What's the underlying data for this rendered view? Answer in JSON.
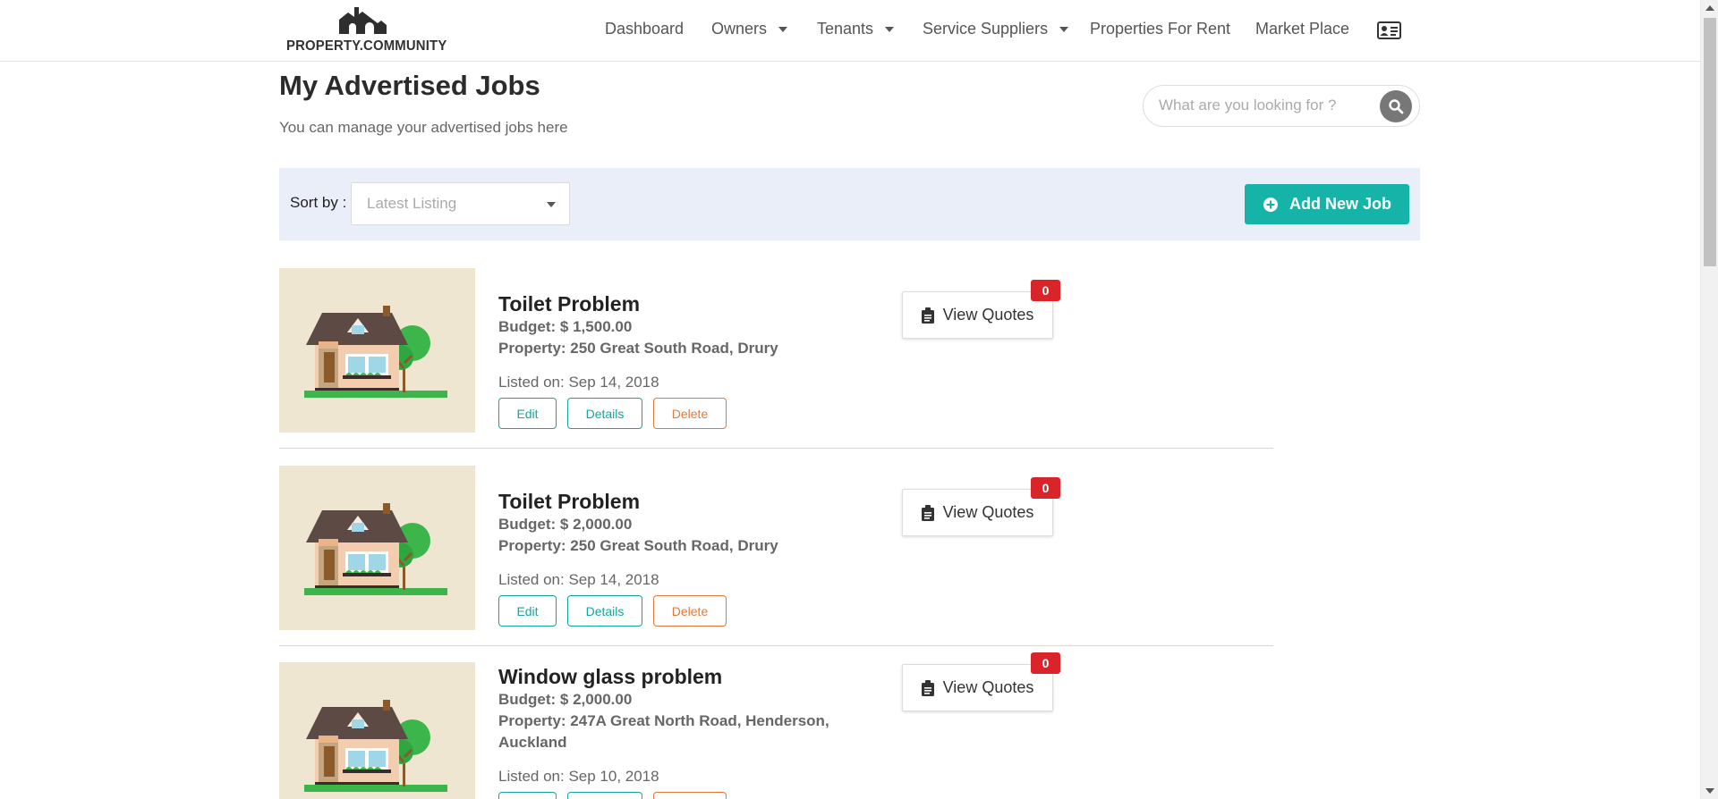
{
  "header": {
    "logo_text": "PROPERTY.COMMUNITY",
    "nav": [
      {
        "label": "Dashboard",
        "dropdown": false
      },
      {
        "label": "Owners",
        "dropdown": true
      },
      {
        "label": "Tenants",
        "dropdown": true
      },
      {
        "label": "Service Suppliers",
        "dropdown": true
      },
      {
        "label": "Properties For Rent",
        "dropdown": false
      },
      {
        "label": "Market Place",
        "dropdown": false
      }
    ],
    "profile_icon": "id-card-icon"
  },
  "page": {
    "title": "My Advertised Jobs",
    "subtitle": "You can manage your advertised jobs here"
  },
  "search": {
    "placeholder": "What are you looking for ?",
    "value": ""
  },
  "sort": {
    "label": "Sort by :",
    "selected": "Latest Listing"
  },
  "actions": {
    "add_new_job": "Add New Job"
  },
  "job_buttons": {
    "edit": "Edit",
    "details": "Details",
    "delete": "Delete",
    "view_quotes": "View Quotes"
  },
  "jobs": [
    {
      "title": "Toilet Problem",
      "budget": "Budget: $ 1,500.00",
      "property": "Property: 250 Great South Road, Drury",
      "listed": "Listed on: Sep 14, 2018",
      "quotes_count": "0"
    },
    {
      "title": "Toilet Problem",
      "budget": "Budget: $ 2,000.00",
      "property": "Property: 250 Great South Road, Drury",
      "listed": "Listed on: Sep 14, 2018",
      "quotes_count": "0"
    },
    {
      "title": "Window glass problem",
      "budget": "Budget: $ 2,000.00",
      "property": "Property: 247A Great North Road, Henderson, Auckland",
      "listed": "Listed on: Sep 10, 2018",
      "quotes_count": "0"
    }
  ],
  "colors": {
    "accent": "#16b3a8",
    "delete": "#e07a3a",
    "badge": "#d9252a",
    "sortbar_bg": "#eaeef8"
  }
}
